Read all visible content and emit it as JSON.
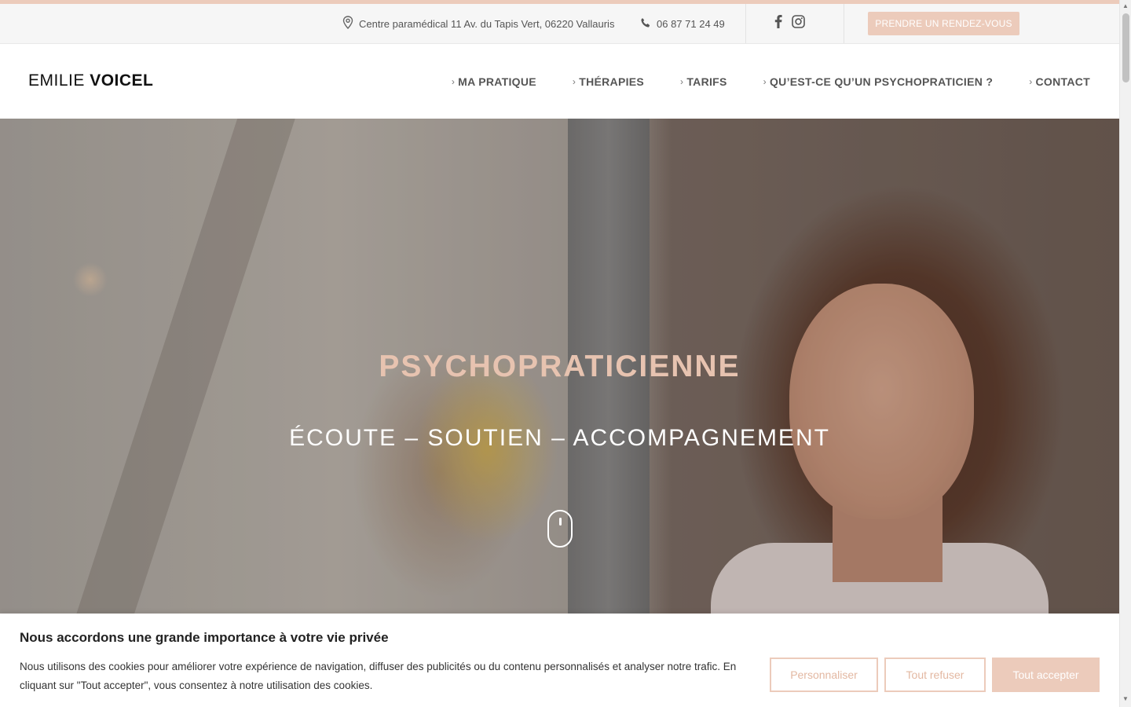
{
  "topbar": {
    "address": "Centre paramédical 11 Av. du Tapis Vert, 06220 Vallauris",
    "phone": "06 87 71 24 49",
    "social": [
      "facebook-icon",
      "instagram-icon"
    ],
    "cta_label": "PRENDRE UN RENDEZ-VOUS"
  },
  "header": {
    "logo_first": "EMILIE",
    "logo_last": "VOICEL",
    "nav": [
      {
        "label": "MA PRATIQUE"
      },
      {
        "label": "THÉRAPIES"
      },
      {
        "label": "TARIFS"
      },
      {
        "label": "QU’EST-CE QU’UN PSYCHOPRATICIEN ?"
      },
      {
        "label": "CONTACT"
      }
    ]
  },
  "hero": {
    "title": "PSYCHOPRATICIENNE",
    "subtitle": "ÉCOUTE – SOUTIEN – ACCOMPAGNEMENT"
  },
  "cookie": {
    "title": "Nous accordons une grande importance à votre vie privée",
    "text": "Nous utilisons des cookies pour améliorer votre expérience de navigation, diffuser des publicités ou du contenu personnalisés et analyser notre trafic. En cliquant sur \"Tout accepter\", vous consentez à notre utilisation des cookies.",
    "customize_label": "Personnaliser",
    "reject_label": "Tout refuser",
    "accept_label": "Tout accepter"
  },
  "colors": {
    "accent": "#eccbbb",
    "hero_title": "#e7c3b0",
    "nav_text": "#555555"
  }
}
